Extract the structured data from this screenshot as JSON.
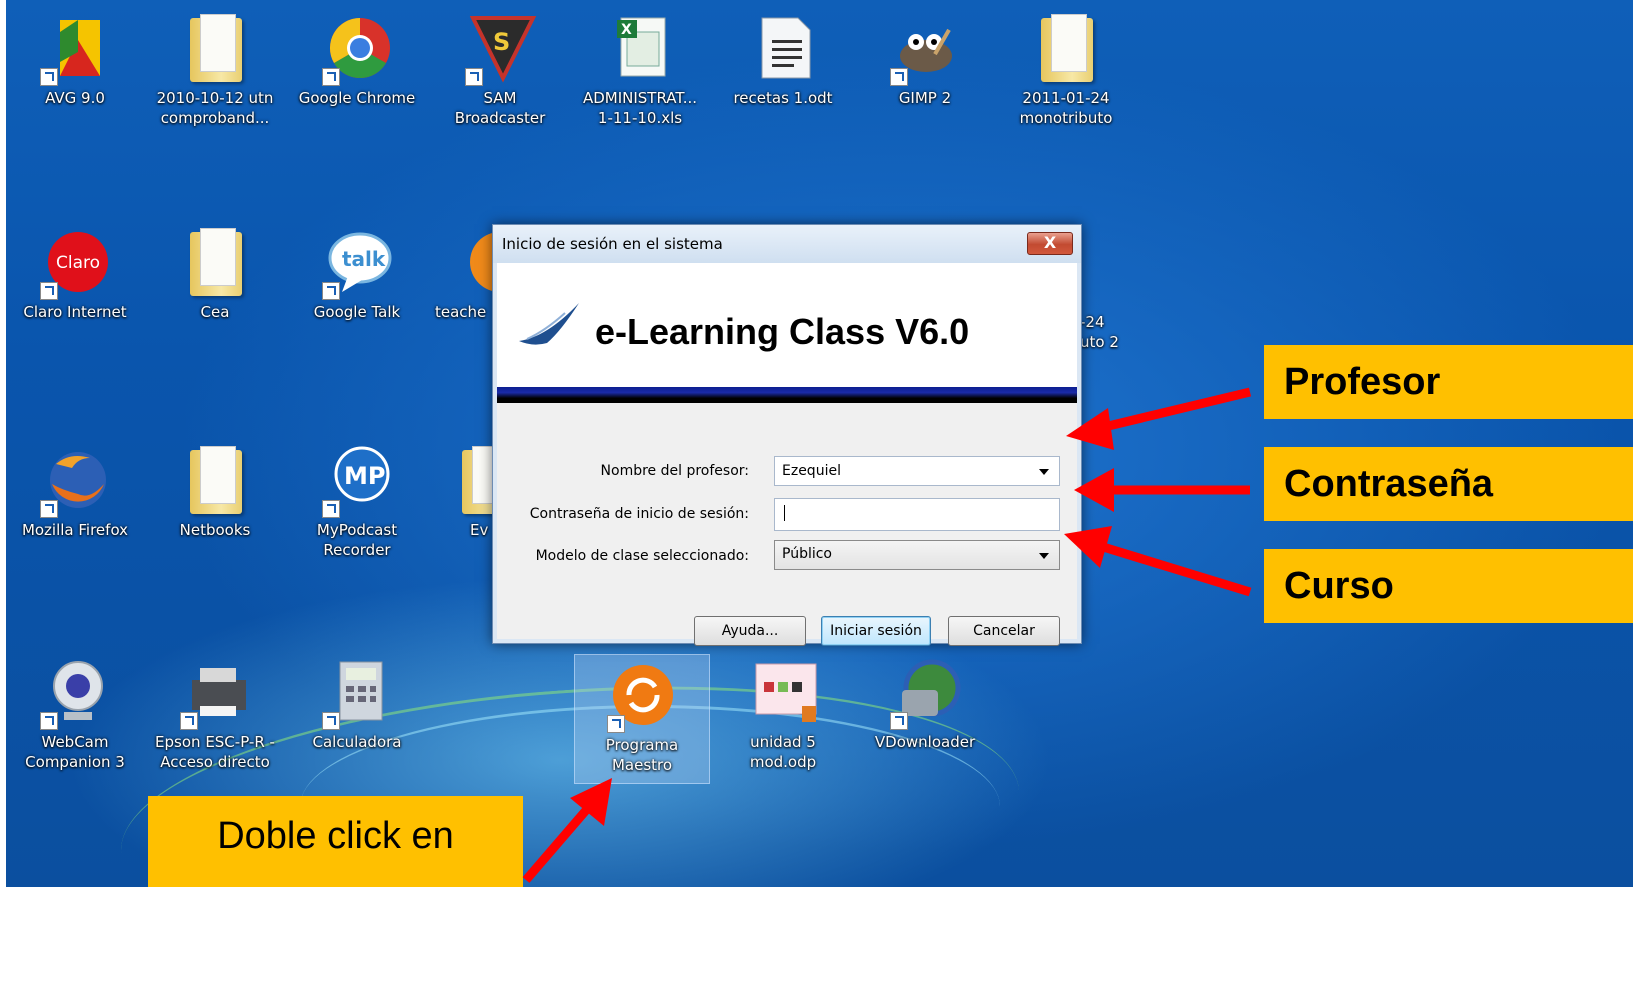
{
  "desktop": {
    "icons": [
      {
        "label": "AVG 9.0",
        "icon": "avg-icon"
      },
      {
        "label": "2010-10-12 utn comproband...",
        "icon": "folder-icon"
      },
      {
        "label": "Google Chrome",
        "icon": "chrome-icon"
      },
      {
        "label": "SAM Broadcaster",
        "icon": "sam-broadcaster-icon"
      },
      {
        "label": "ADMINISTRAT... 1-11-10.xls",
        "icon": "excel-file-icon"
      },
      {
        "label": "recetas 1.odt",
        "icon": "document-icon"
      },
      {
        "label": "GIMP 2",
        "icon": "gimp-icon"
      },
      {
        "label": "2011-01-24 monotributo",
        "icon": "folder-icon"
      },
      {
        "label": "Claro Internet",
        "icon": "claro-icon"
      },
      {
        "label": "Cea",
        "icon": "folder-icon"
      },
      {
        "label": "Google Talk",
        "icon": "google-talk-icon"
      },
      {
        "label": "teache",
        "icon": "orange-app-icon"
      },
      {
        "label": "-24",
        "icon": "hidden-icon"
      },
      {
        "label": "uto 2",
        "icon": "hidden-icon"
      },
      {
        "label": "Mozilla Firefox",
        "icon": "firefox-icon"
      },
      {
        "label": "Netbooks",
        "icon": "folder-icon"
      },
      {
        "label": "MyPodcast Recorder",
        "icon": "mypodcast-icon"
      },
      {
        "label": "Ev",
        "icon": "folder-icon"
      },
      {
        "label": "WebCam Companion 3",
        "icon": "webcam-icon"
      },
      {
        "label": "Epson ESC-P-R - Acceso directo",
        "icon": "printer-icon"
      },
      {
        "label": "Calculadora",
        "icon": "calculator-icon"
      },
      {
        "label": "Programa Maestro",
        "icon": "programa-maestro-icon"
      },
      {
        "label": "unidad 5 mod.odp",
        "icon": "presentation-icon"
      },
      {
        "label": "VDownloader",
        "icon": "vdownloader-icon"
      }
    ]
  },
  "dialog": {
    "title": "Inicio de sesión en el sistema",
    "close_label": "X",
    "brand": "e-Learning Class V6.0",
    "fields": {
      "teacher_label": "Nombre del profesor:",
      "teacher_value": "Ezequiel",
      "password_label": "Contraseña de inicio de sesión:",
      "password_value": "",
      "model_label": "Modelo de clase seleccionado:",
      "model_value": "Público"
    },
    "buttons": {
      "help": "Ayuda...",
      "login": "Iniciar sesión",
      "cancel": "Cancelar"
    }
  },
  "callouts": {
    "profesor": "Profesor",
    "contrasena": "Contraseña",
    "curso": "Curso",
    "doble_click": "Doble  click en"
  },
  "colors": {
    "callout_bg": "#ffc000",
    "arrow": "#ff0000",
    "desktop_blue": "#0f5fb8"
  }
}
